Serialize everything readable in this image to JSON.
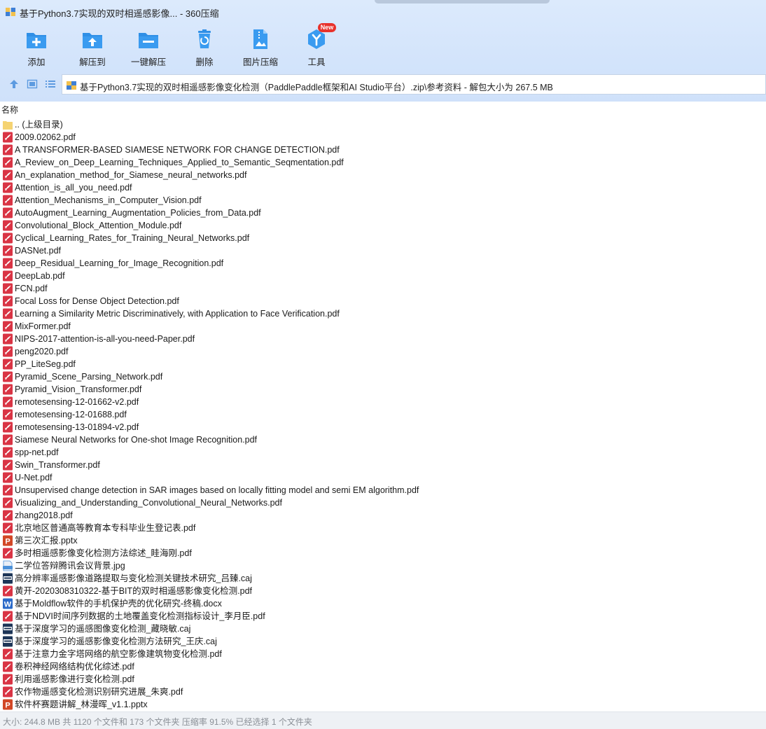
{
  "window": {
    "title": "基于Python3.7实现的双时相遥感影像... - 360压缩"
  },
  "toolbar": {
    "items": [
      {
        "label": "添加",
        "icon": "add-icon"
      },
      {
        "label": "解压到",
        "icon": "extract-to-icon"
      },
      {
        "label": "一键解压",
        "icon": "one-click-extract-icon"
      },
      {
        "label": "删除",
        "icon": "delete-icon"
      },
      {
        "label": "图片压缩",
        "icon": "image-compress-icon"
      },
      {
        "label": "工具",
        "icon": "tools-icon"
      }
    ],
    "new_badge": "New"
  },
  "address": {
    "path": "基于Python3.7实现的双时相遥感影像变化检测（PaddlePaddle框架和AI Studio平台）.zip\\参考资料 - 解包大小为 267.5 MB"
  },
  "list": {
    "column_name": "名称",
    "files": [
      {
        "name": ".. (上级目录)",
        "type": "folder"
      },
      {
        "name": "2009.02062.pdf",
        "type": "pdf"
      },
      {
        "name": "A TRANSFORMER-BASED SIAMESE NETWORK FOR CHANGE DETECTION.pdf",
        "type": "pdf"
      },
      {
        "name": "A_Review_on_Deep_Learning_Techniques_Applied_to_Semantic_Seqmentation.pdf",
        "type": "pdf"
      },
      {
        "name": "An_explanation_method_for_Siamese_neural_networks.pdf",
        "type": "pdf"
      },
      {
        "name": "Attention_is_all_you_need.pdf",
        "type": "pdf"
      },
      {
        "name": "Attention_Mechanisms_in_Computer_Vision.pdf",
        "type": "pdf"
      },
      {
        "name": "AutoAugment_Learning_Augmentation_Policies_from_Data.pdf",
        "type": "pdf"
      },
      {
        "name": "Convolutional_Block_Attention_Module.pdf",
        "type": "pdf"
      },
      {
        "name": "Cyclical_Learning_Rates_for_Training_Neural_Networks.pdf",
        "type": "pdf"
      },
      {
        "name": "DASNet.pdf",
        "type": "pdf"
      },
      {
        "name": "Deep_Residual_Learning_for_Image_Recognition.pdf",
        "type": "pdf"
      },
      {
        "name": "DeepLab.pdf",
        "type": "pdf"
      },
      {
        "name": "FCN.pdf",
        "type": "pdf"
      },
      {
        "name": "Focal Loss for Dense Object Detection.pdf",
        "type": "pdf"
      },
      {
        "name": "Learning a Similarity Metric Discriminatively, with Application to Face Verification.pdf",
        "type": "pdf"
      },
      {
        "name": "MixFormer.pdf",
        "type": "pdf"
      },
      {
        "name": "NIPS-2017-attention-is-all-you-need-Paper.pdf",
        "type": "pdf"
      },
      {
        "name": "peng2020.pdf",
        "type": "pdf"
      },
      {
        "name": "PP_LiteSeg.pdf",
        "type": "pdf"
      },
      {
        "name": "Pyramid_Scene_Parsing_Network.pdf",
        "type": "pdf"
      },
      {
        "name": "Pyramid_Vision_Transformer.pdf",
        "type": "pdf"
      },
      {
        "name": "remotesensing-12-01662-v2.pdf",
        "type": "pdf"
      },
      {
        "name": "remotesensing-12-01688.pdf",
        "type": "pdf"
      },
      {
        "name": "remotesensing-13-01894-v2.pdf",
        "type": "pdf"
      },
      {
        "name": "Siamese Neural Networks for One-shot Image Recognition.pdf",
        "type": "pdf"
      },
      {
        "name": "spp-net.pdf",
        "type": "pdf"
      },
      {
        "name": "Swin_Transformer.pdf",
        "type": "pdf"
      },
      {
        "name": "U-Net.pdf",
        "type": "pdf"
      },
      {
        "name": "Unsupervised change detection in SAR images based on locally fitting model and semi EM algorithm.pdf",
        "type": "pdf"
      },
      {
        "name": "Visualizing_and_Understanding_Convolutional_Neural_Networks.pdf",
        "type": "pdf"
      },
      {
        "name": "zhang2018.pdf",
        "type": "pdf"
      },
      {
        "name": "北京地区普通高等教育本专科毕业生登记表.pdf",
        "type": "pdf"
      },
      {
        "name": "第三次汇报.pptx",
        "type": "pptx"
      },
      {
        "name": "多时相遥感影像变化检测方法综述_眭海刚.pdf",
        "type": "pdf"
      },
      {
        "name": "二学位答辩腾讯会议背景.jpg",
        "type": "jpg"
      },
      {
        "name": "高分辨率遥感影像道路提取与变化检测关键技术研究_吕臻.caj",
        "type": "caj"
      },
      {
        "name": "黄开-2020308310322-基于BIT的双时相遥感影像变化检测.pdf",
        "type": "pdf"
      },
      {
        "name": "基于Moldflow软件的手机保护壳的优化研究-终稿.docx",
        "type": "docx"
      },
      {
        "name": "基于NDVI时间序列数据的土地覆盖变化检测指标设计_李月臣.pdf",
        "type": "pdf"
      },
      {
        "name": "基于深度学习的遥感图像变化检测_藏晓敏.caj",
        "type": "caj"
      },
      {
        "name": "基于深度学习的遥感影像变化检测方法研究_王庆.caj",
        "type": "caj"
      },
      {
        "name": "基于注意力金字塔网络的航空影像建筑物变化检测.pdf",
        "type": "pdf"
      },
      {
        "name": "卷积神经网络结构优化综述.pdf",
        "type": "pdf"
      },
      {
        "name": "利用遥感影像进行变化检测.pdf",
        "type": "pdf"
      },
      {
        "name": "农作物遥感变化检测识别研究进展_朱爽.pdf",
        "type": "pdf"
      },
      {
        "name": "软件杯赛题讲解_林漫晖_v1.1.pptx",
        "type": "pptx"
      }
    ]
  },
  "status": {
    "text": "大小: 244.8 MB 共 1120 个文件和 173 个文件夹 压缩率 91.5% 已经选择 1 个文件夹"
  },
  "colors": {
    "pdf": "#d93444",
    "pptx": "#d24726",
    "docx": "#2b6ac9",
    "caj": "#1d3557",
    "jpg": "#4a90d9",
    "folder": "#f5d372",
    "toolbar_icon": "#2f8fe6"
  }
}
